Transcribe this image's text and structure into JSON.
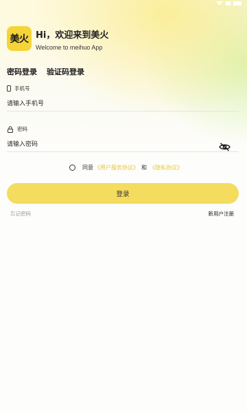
{
  "header": {
    "logo_text": "美火",
    "greeting": "Hi，欢迎来到美火",
    "subtitle": "Welcome to meihuo App"
  },
  "tabs": [
    {
      "label": "密码登录",
      "active": true
    },
    {
      "label": "验证码登录",
      "active": false
    }
  ],
  "phone_field": {
    "label": "手机号",
    "placeholder": "请输入手机号",
    "value": ""
  },
  "password_field": {
    "label": "密码",
    "placeholder": "请输入密码",
    "value": "",
    "visibility_icon": "eye-off-icon"
  },
  "agreement": {
    "prefix": "同意",
    "terms_link": "《用户服务协议》",
    "conjunction": "和",
    "privacy_link": "《隐私协议》",
    "checked": false
  },
  "login_button": {
    "label": "登录"
  },
  "footer": {
    "forgot_password": "忘记密码",
    "register": "新用户注册"
  },
  "colors": {
    "brand_yellow": "#f5d43a",
    "button_yellow": "#f4dc5e",
    "link_yellow": "#e8c53c"
  }
}
